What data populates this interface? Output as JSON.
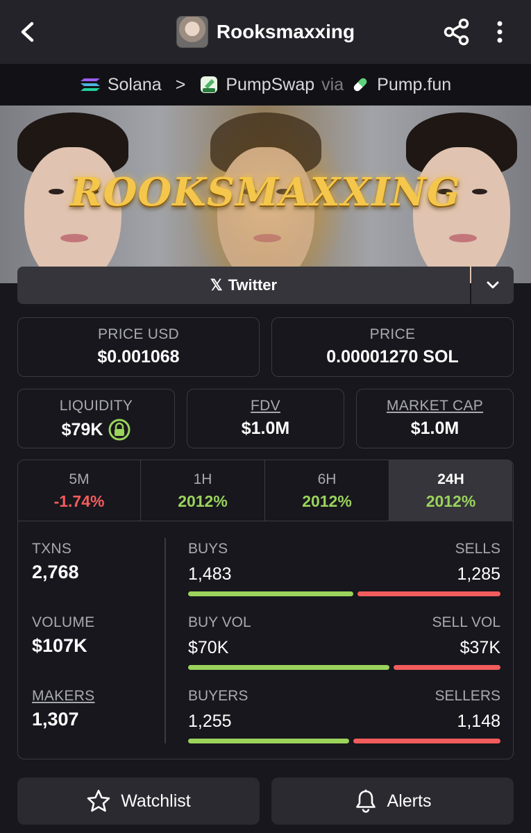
{
  "header": {
    "title": "Rooksmaxxing",
    "back_icon": "chevron-left-icon",
    "share_icon": "share-icon",
    "menu_icon": "more-vertical-icon"
  },
  "chain": {
    "network": "Solana",
    "separator": ">",
    "dex": "PumpSwap",
    "via": "via",
    "launchpad": "Pump.fun"
  },
  "banner": {
    "text": "ROOKSMAXXING"
  },
  "social": {
    "twitter_label": "Twitter",
    "twitter_glyph": "𝕏"
  },
  "price": {
    "usd_label": "PRICE USD",
    "usd_value": "$0.001068",
    "native_label": "PRICE",
    "native_value": "0.00001270 SOL"
  },
  "metrics": {
    "liquidity_label": "LIQUIDITY",
    "liquidity_value": "$79K",
    "fdv_label": "FDV",
    "fdv_value": "$1.0M",
    "mcap_label": "MARKET CAP",
    "mcap_value": "$1.0M"
  },
  "tabs": [
    {
      "label": "5M",
      "change": "-1.74%"
    },
    {
      "label": "1H",
      "change": "2012%"
    },
    {
      "label": "6H",
      "change": "2012%"
    },
    {
      "label": "24H",
      "change": "2012%"
    }
  ],
  "stats": {
    "txns_label": "TXNS",
    "txns_value": "2,768",
    "volume_label": "VOLUME",
    "volume_value": "$107K",
    "makers_label": "MAKERS",
    "makers_value": "1,307",
    "buys_label": "BUYS",
    "buys_value": "1,483",
    "sells_label": "SELLS",
    "sells_value": "1,285",
    "buy_vol_label": "BUY VOL",
    "buy_vol_value": "$70K",
    "sell_vol_label": "SELL VOL",
    "sell_vol_value": "$37K",
    "buyers_label": "BUYERS",
    "buyers_value": "1,255",
    "sellers_label": "SELLERS",
    "sellers_value": "1,148"
  },
  "ratios": {
    "buys_share": 0.536,
    "buy_vol_share": 0.654,
    "buyers_share": 0.522
  },
  "colors": {
    "positive": "#9bd35c",
    "negative": "#f25c5c",
    "background": "#17171d"
  },
  "actions": {
    "watchlist_label": "Watchlist",
    "alerts_label": "Alerts"
  }
}
